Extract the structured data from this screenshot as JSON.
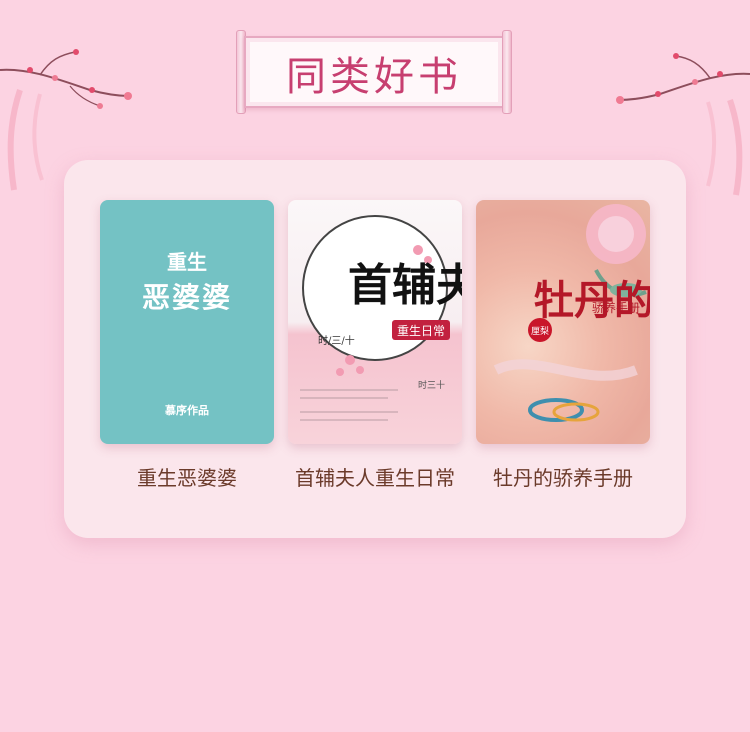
{
  "header": {
    "title": "同类好书"
  },
  "books": [
    {
      "title": "重生恶婆婆",
      "cover": {
        "line1": "重生",
        "line2": "恶婆婆",
        "author": "慕序作品"
      }
    },
    {
      "title": "首辅夫人重生日常",
      "cover": {
        "calligraphy": "首辅夫人",
        "subtitle": "重生日常",
        "author": "时/三/十",
        "author_side": "时三十"
      }
    },
    {
      "title": "牡丹的骄养手册",
      "cover": {
        "calligraphy": "牡丹的",
        "subtitle": "骄养手册",
        "seal": "厘梨"
      }
    }
  ],
  "colors": {
    "background": "#fcd3e2",
    "panel": "#fbe6ec",
    "title": "#c73f70",
    "book_title": "#6b3a2a"
  }
}
